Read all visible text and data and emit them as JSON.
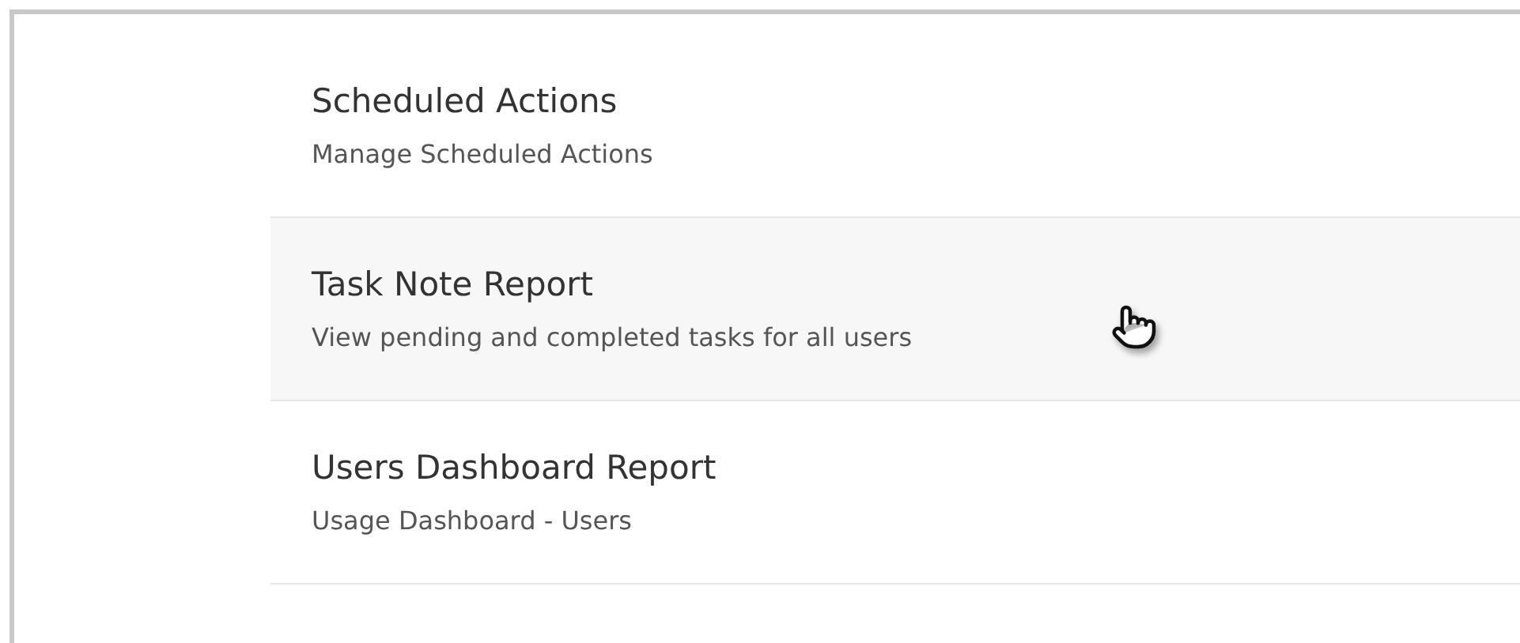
{
  "items": [
    {
      "title": "Scheduled Actions",
      "description": "Manage Scheduled Actions",
      "hovered": false
    },
    {
      "title": "Task Note Report",
      "description": "View pending and completed tasks for all users",
      "hovered": true
    },
    {
      "title": "Users Dashboard Report",
      "description": "Usage Dashboard - Users",
      "hovered": false
    }
  ]
}
